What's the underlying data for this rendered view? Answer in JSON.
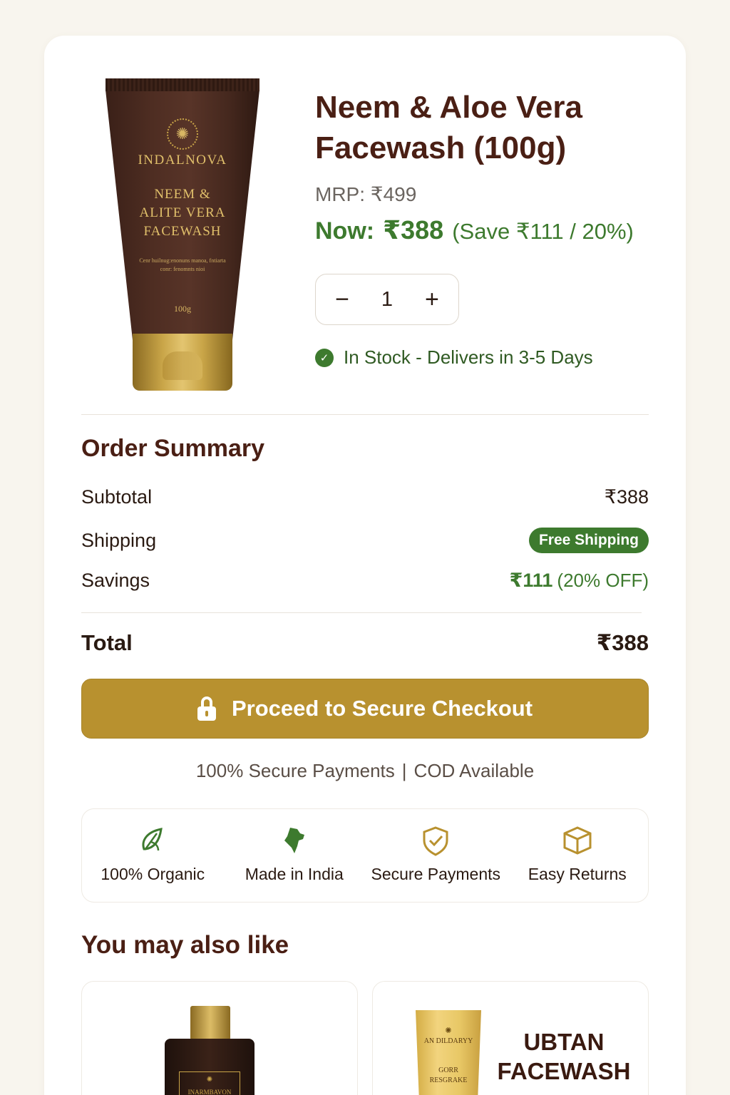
{
  "product": {
    "title": "Neem & Aloe Vera Facewash (100g)",
    "mrp": "MRP: ₹499",
    "now_label": "Now:",
    "now_price": "₹388",
    "save_text": "(Save ₹111 / 20%)",
    "quantity": "1",
    "qty_minus": "−",
    "qty_plus": "+",
    "stock_text": "In Stock - Delivers in 3-5 Days",
    "image": {
      "brand": "INDALNOVA",
      "name_line1": "NEEM &",
      "name_line2": "ALITE VERA",
      "name_line3": "FACEWASH",
      "description": "Cenr huilnug:enonuns manoa, fntiarta conr: fenomnts nioi",
      "size": "100g",
      "logo_glyph": "✺"
    }
  },
  "order_summary": {
    "title": "Order Summary",
    "subtotal_label": "Subtotal",
    "subtotal_value": "₹388",
    "shipping_label": "Shipping",
    "shipping_badge": "Free Shipping",
    "savings_label": "Savings",
    "savings_amount": "₹111",
    "savings_pct": "(20% OFF)",
    "total_label": "Total",
    "total_value": "₹388"
  },
  "checkout": {
    "button_label": "Proceed to Secure Checkout",
    "secure_text_left": "100% Secure Payments",
    "separator": "|",
    "secure_text_right": "COD Available"
  },
  "features": [
    {
      "label": "100% Organic",
      "icon": "organic-leaf-icon"
    },
    {
      "label": "Made in India",
      "icon": "india-map-icon"
    },
    {
      "label": "Secure Payments",
      "icon": "shield-check-icon"
    },
    {
      "label": "Easy Returns",
      "icon": "box-icon"
    }
  ],
  "recommendations": {
    "title": "You may also like",
    "items": [
      {
        "image_mark": "✺",
        "image_text": "INARMBAVON"
      },
      {
        "image_mark": "✺",
        "image_brand": "AN DILDARYY",
        "image_sub1": "GORR",
        "image_sub2": "RESGRAKE",
        "title_line1": "UBTAN",
        "title_line2": "FACEWASH"
      }
    ]
  },
  "colors": {
    "brand_brown": "#4a1f14",
    "accent_gold": "#b8912f",
    "success_green": "#3d7a2e",
    "page_bg": "#f8f5ee"
  }
}
